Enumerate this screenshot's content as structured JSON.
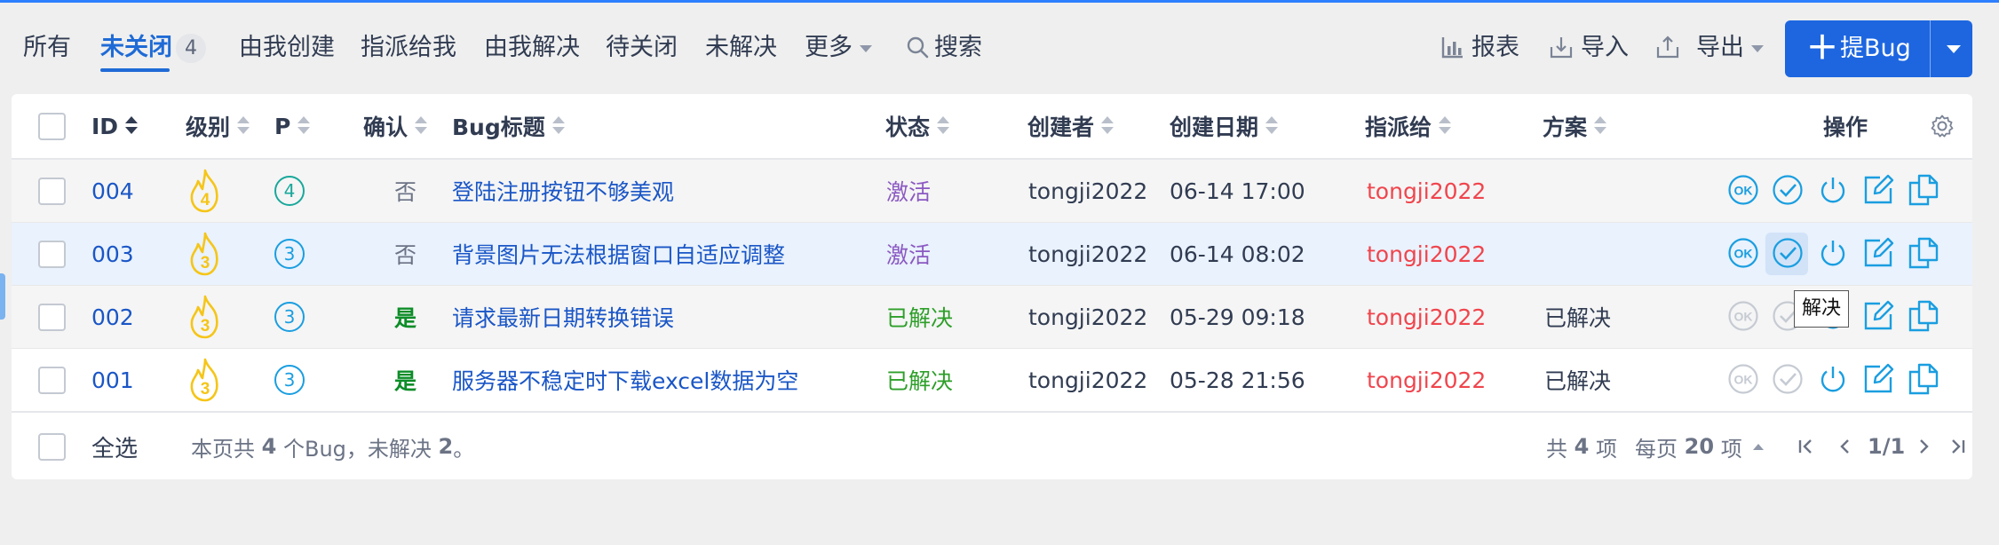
{
  "tabs": {
    "all": "所有",
    "unclosed": "未关闭",
    "unclosed_count": "4",
    "created_by_me": "由我创建",
    "assigned_to_me": "指派给我",
    "resolved_by_me": "由我解决",
    "to_close": "待关闭",
    "unresolved": "未解决",
    "more": "更多",
    "search": "搜索"
  },
  "actions": {
    "report": "报表",
    "import": "导入",
    "export": "导出",
    "create_bug": "提Bug"
  },
  "table": {
    "headers": {
      "id": "ID",
      "severity": "级别",
      "priority": "P",
      "confirmed": "确认",
      "title": "Bug标题",
      "status": "状态",
      "creator": "创建者",
      "created_date": "创建日期",
      "assigned_to": "指派给",
      "resolution": "方案",
      "operations": "操作"
    },
    "rows": [
      {
        "id": "004",
        "severity": "4",
        "priority": "4",
        "confirmed": "否",
        "title": "登陆注册按钮不够美观",
        "status": "激活",
        "creator": "tongji2022",
        "date": "06-14 17:00",
        "assigned": "tongji2022",
        "resolution": ""
      },
      {
        "id": "003",
        "severity": "3",
        "priority": "3",
        "confirmed": "否",
        "title": "背景图片无法根据窗口自适应调整",
        "status": "激活",
        "creator": "tongji2022",
        "date": "06-14 08:02",
        "assigned": "tongji2022",
        "resolution": ""
      },
      {
        "id": "002",
        "severity": "3",
        "priority": "3",
        "confirmed": "是",
        "title": "请求最新日期转换错误",
        "status": "已解决",
        "creator": "tongji2022",
        "date": "05-29 09:18",
        "assigned": "tongji2022",
        "resolution": "已解决"
      },
      {
        "id": "001",
        "severity": "3",
        "priority": "3",
        "confirmed": "是",
        "title": "服务器不稳定时下载excel数据为空",
        "status": "已解决",
        "creator": "tongji2022",
        "date": "05-28 21:56",
        "assigned": "tongji2022",
        "resolution": "已解决"
      }
    ],
    "tooltip": "解决"
  },
  "footer": {
    "select_all": "全选",
    "summary_prefix": "本页共",
    "summary_count": "4",
    "summary_mid": "个Bug，未解决",
    "summary_unresolved": "2",
    "summary_suffix": "。",
    "total_prefix": "共",
    "total_count": "4",
    "total_suffix": "项",
    "per_page_prefix": "每页",
    "per_page": "20",
    "per_page_suffix": "项",
    "page": "1/1"
  },
  "colors": {
    "primary": "#1d66e0",
    "active_tab": "#1f6bd6",
    "link": "#1a56c6",
    "status_active": "#8b59c2",
    "status_resolved": "#2e9f2a",
    "assignee": "#f0454d",
    "severity": "#f5c518"
  },
  "icons": [
    "chart-icon",
    "import-icon",
    "export-icon",
    "search-icon",
    "settings-icon",
    "confirm-icon",
    "resolve-icon",
    "close-icon",
    "edit-icon",
    "copy-icon",
    "flame-icon"
  ]
}
